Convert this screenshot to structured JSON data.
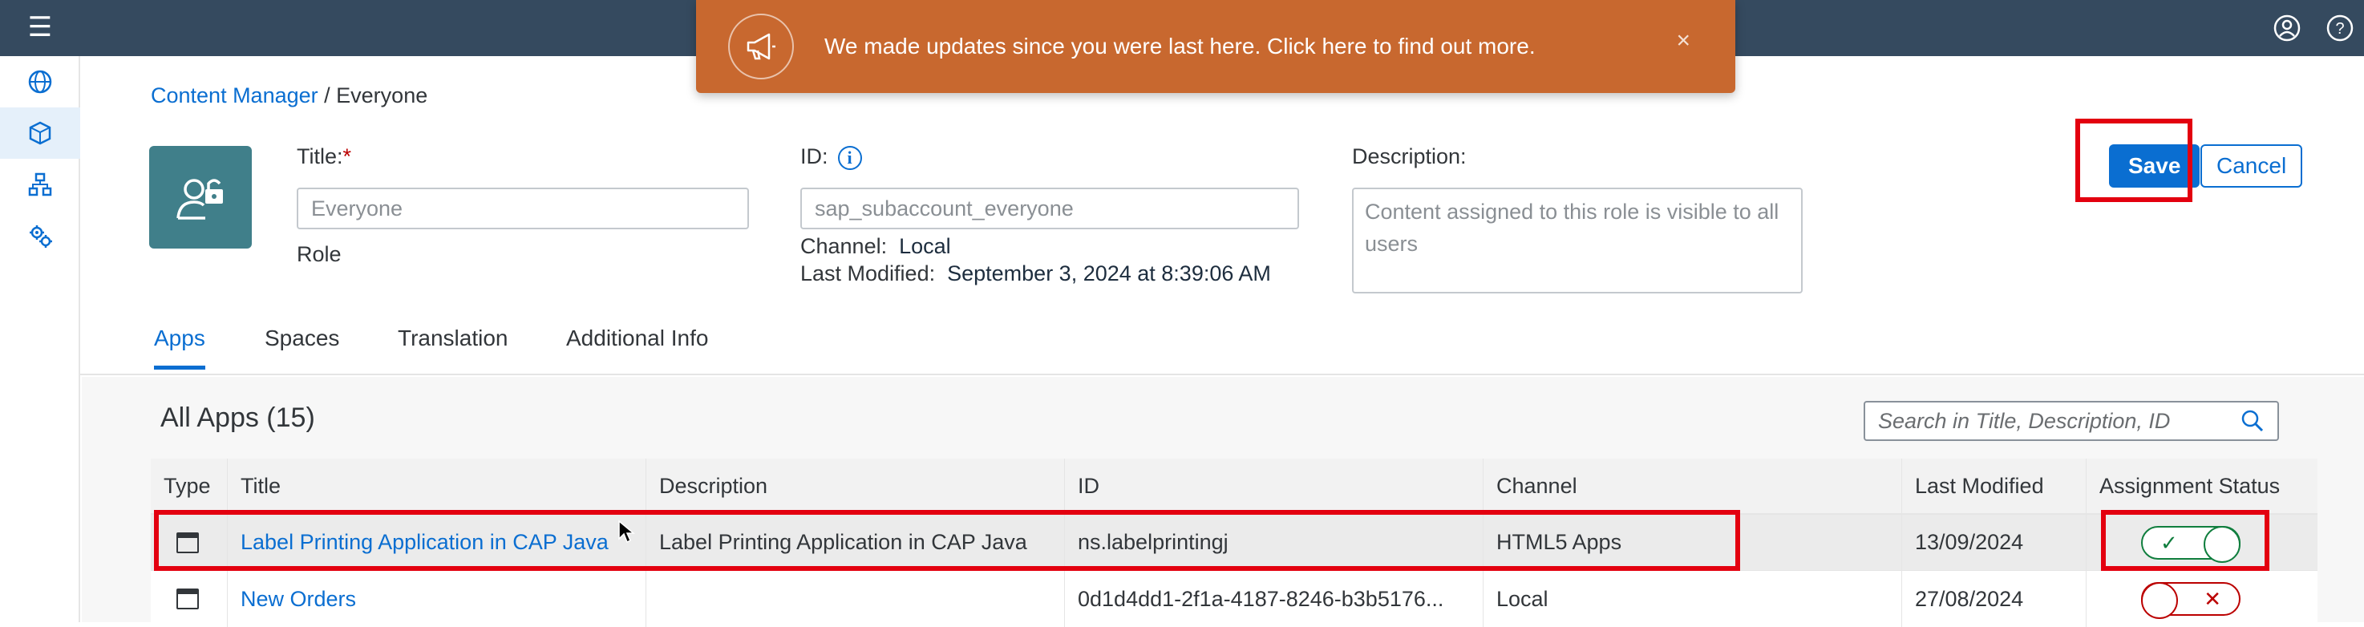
{
  "shell": {
    "menu_icon": "hamburger-menu-icon",
    "user_icon": "user-account-icon",
    "help_icon": "help-icon"
  },
  "sidenav": {
    "items": [
      {
        "icon": "globe-icon",
        "active": false
      },
      {
        "icon": "cube-icon",
        "active": true
      },
      {
        "icon": "hierarchy-icon",
        "active": false
      },
      {
        "icon": "gears-icon",
        "active": false
      }
    ]
  },
  "toast": {
    "text": "We made updates since you were last here. Click here to find out more.",
    "icon": "megaphone-icon",
    "close": "×"
  },
  "breadcrumb": {
    "parent": "Content Manager",
    "separator": " / ",
    "current": "Everyone"
  },
  "role": {
    "title_label": "Title:",
    "required_mark": "*",
    "title_value": "Everyone",
    "type": "Role",
    "id_label": "ID:",
    "id_value": "sap_subaccount_everyone",
    "channel_label": "Channel:",
    "channel_value": "Local",
    "modified_label": "Last Modified:",
    "modified_value": "September 3, 2024 at 8:39:06 AM",
    "description_label": "Description:",
    "description_value": "Content assigned to this role is visible to all users"
  },
  "actions": {
    "save": "Save",
    "cancel": "Cancel"
  },
  "tabs": [
    {
      "label": "Apps",
      "active": true
    },
    {
      "label": "Spaces",
      "active": false
    },
    {
      "label": "Translation",
      "active": false
    },
    {
      "label": "Additional Info",
      "active": false
    }
  ],
  "apps": {
    "title": "All Apps (15)",
    "search_placeholder": "Search in Title, Description, ID",
    "columns": [
      "Type",
      "Title",
      "Description",
      "ID",
      "Channel",
      "Last Modified",
      "Assignment Status"
    ],
    "rows": [
      {
        "title": "Label Printing Application in CAP Java",
        "description": "Label Printing Application in CAP Java",
        "id": "ns.labelprintingj",
        "channel": "HTML5 Apps",
        "modified": "13/09/2024",
        "assigned": true
      },
      {
        "title": "New Orders",
        "description": "",
        "id": "0d1d4dd1-2f1a-4187-8246-b3b5176...",
        "channel": "Local",
        "modified": "27/08/2024",
        "assigned": false
      }
    ]
  },
  "colors": {
    "shell": "#354a5f",
    "toast": "#c8682f",
    "accent": "#0a6ed1",
    "highlight": "#e3000f",
    "avatar": "#407f8a"
  }
}
